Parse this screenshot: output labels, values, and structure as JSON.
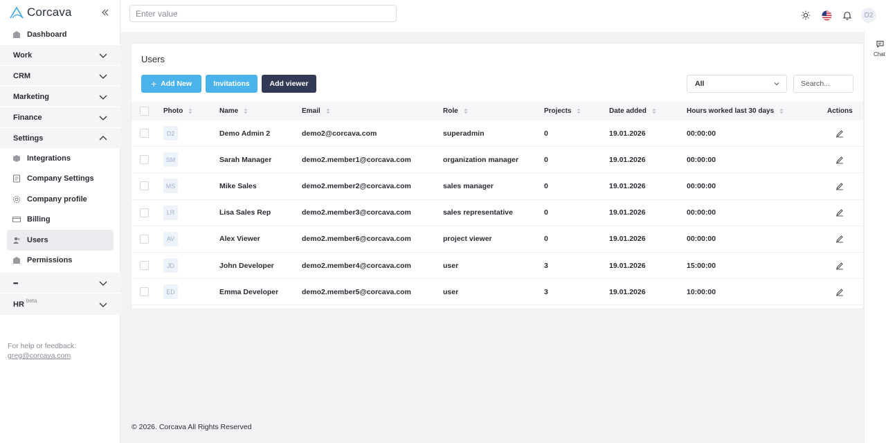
{
  "brand": {
    "name": "Corcava"
  },
  "sidebar": {
    "dashboard": "Dashboard",
    "sections": [
      {
        "label": "Work"
      },
      {
        "label": "CRM"
      },
      {
        "label": "Marketing"
      },
      {
        "label": "Finance"
      },
      {
        "label": "Settings"
      }
    ],
    "settings_items": [
      {
        "label": "Integrations"
      },
      {
        "label": "Company Settings"
      },
      {
        "label": "Company profile"
      },
      {
        "label": "Billing"
      },
      {
        "label": "Users"
      },
      {
        "label": "Permissions"
      }
    ],
    "more": "•••",
    "hr": "HR",
    "hr_badge": "beta",
    "help_text": "For help or feedback:",
    "help_email": "greg@corcava.com"
  },
  "topbar": {
    "search_placeholder": "Enter value",
    "avatar": "D2"
  },
  "chat": {
    "label": "Chat"
  },
  "page": {
    "title": "Users",
    "buttons": {
      "add_new": "Add New",
      "invitations": "Invitations",
      "add_viewer": "Add viewer"
    },
    "filter_value": "All",
    "search_placeholder": "Search..."
  },
  "table": {
    "headers": {
      "photo": "Photo",
      "name": "Name",
      "email": "Email",
      "role": "Role",
      "projects": "Projects",
      "date_added": "Date added",
      "hours": "Hours worked last 30 days",
      "actions": "Actions"
    },
    "rows": [
      {
        "initials": "D2",
        "name": "Demo Admin 2",
        "email": "demo2@corcava.com",
        "role": "superadmin",
        "projects": "0",
        "date": "19.01.2026",
        "hours": "00:00:00"
      },
      {
        "initials": "SM",
        "name": "Sarah Manager",
        "email": "demo2.member1@corcava.com",
        "role": "organization manager",
        "projects": "0",
        "date": "19.01.2026",
        "hours": "00:00:00"
      },
      {
        "initials": "MS",
        "name": "Mike Sales",
        "email": "demo2.member2@corcava.com",
        "role": "sales manager",
        "projects": "0",
        "date": "19.01.2026",
        "hours": "00:00:00"
      },
      {
        "initials": "LR",
        "name": "Lisa Sales Rep",
        "email": "demo2.member3@corcava.com",
        "role": "sales representative",
        "projects": "0",
        "date": "19.01.2026",
        "hours": "00:00:00"
      },
      {
        "initials": "AV",
        "name": "Alex Viewer",
        "email": "demo2.member6@corcava.com",
        "role": "project viewer",
        "projects": "0",
        "date": "19.01.2026",
        "hours": "00:00:00"
      },
      {
        "initials": "JD",
        "name": "John Developer",
        "email": "demo2.member4@corcava.com",
        "role": "user",
        "projects": "3",
        "date": "19.01.2026",
        "hours": "15:00:00"
      },
      {
        "initials": "ED",
        "name": "Emma Developer",
        "email": "demo2.member5@corcava.com",
        "role": "user",
        "projects": "3",
        "date": "19.01.2026",
        "hours": "10:00:00"
      }
    ]
  },
  "footer": {
    "text": "© 2026. Corcava All Rights Reserved"
  }
}
